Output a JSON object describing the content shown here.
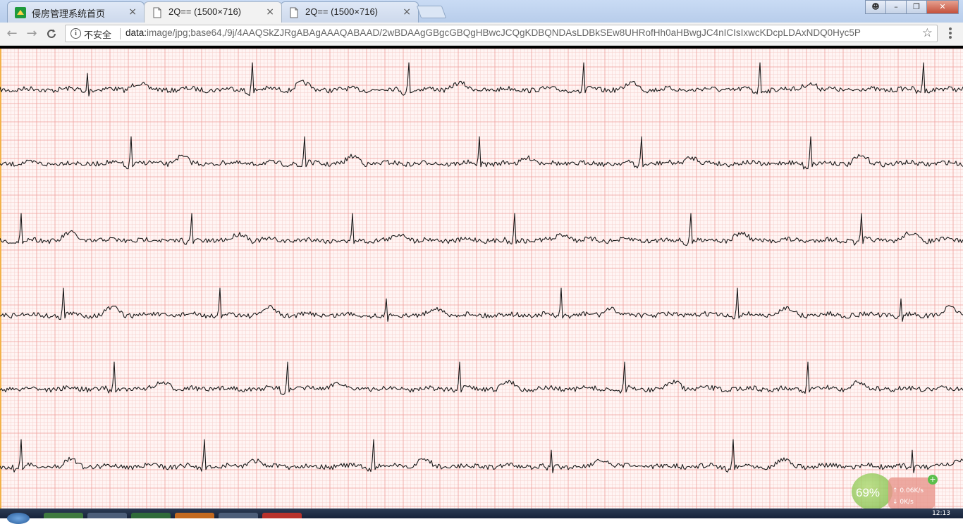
{
  "browser": {
    "tabs": [
      {
        "title": "侵房管理系统首页",
        "active": false,
        "icon": "app-logo-icon"
      },
      {
        "title": "2Q== (1500×716)",
        "active": true,
        "icon": "page-icon"
      },
      {
        "title": "2Q== (1500×716)",
        "active": false,
        "icon": "page-icon"
      }
    ],
    "tab_close_glyph": "×",
    "window_controls": {
      "user": "user-icon",
      "minimize": "minimize-icon",
      "maximize": "maximize-icon",
      "close": "close-icon"
    },
    "security_label": "不安全",
    "url_scheme": "data:",
    "url_rest": "image/jpg;base64,/9j/4AAQSkZJRgABAgAAAQABAAD/2wBDAAgGBgcGBQgHBwcJCQgKDBQNDAsLDBkSEw8UHRofHh0aHBwgJC4nICIsIxwcKDcpLDAxNDQ0Hyc5P",
    "nav_back": "←",
    "nav_forward": "→",
    "nav_reload": "C",
    "bookmark_star": "☆"
  },
  "content": {
    "description_type": "ecg-strip-image",
    "grid_colors": {
      "background": "#fff5f4",
      "minor": "#f6cfcc",
      "major": "#ef9f9a",
      "trace": "#1a1a1a"
    },
    "strip_count": 6
  },
  "desktop_widget": {
    "percent": "69%",
    "upload": "0.06K/s",
    "download": "0K/s"
  },
  "taskbar": {
    "clock": "12:13"
  }
}
